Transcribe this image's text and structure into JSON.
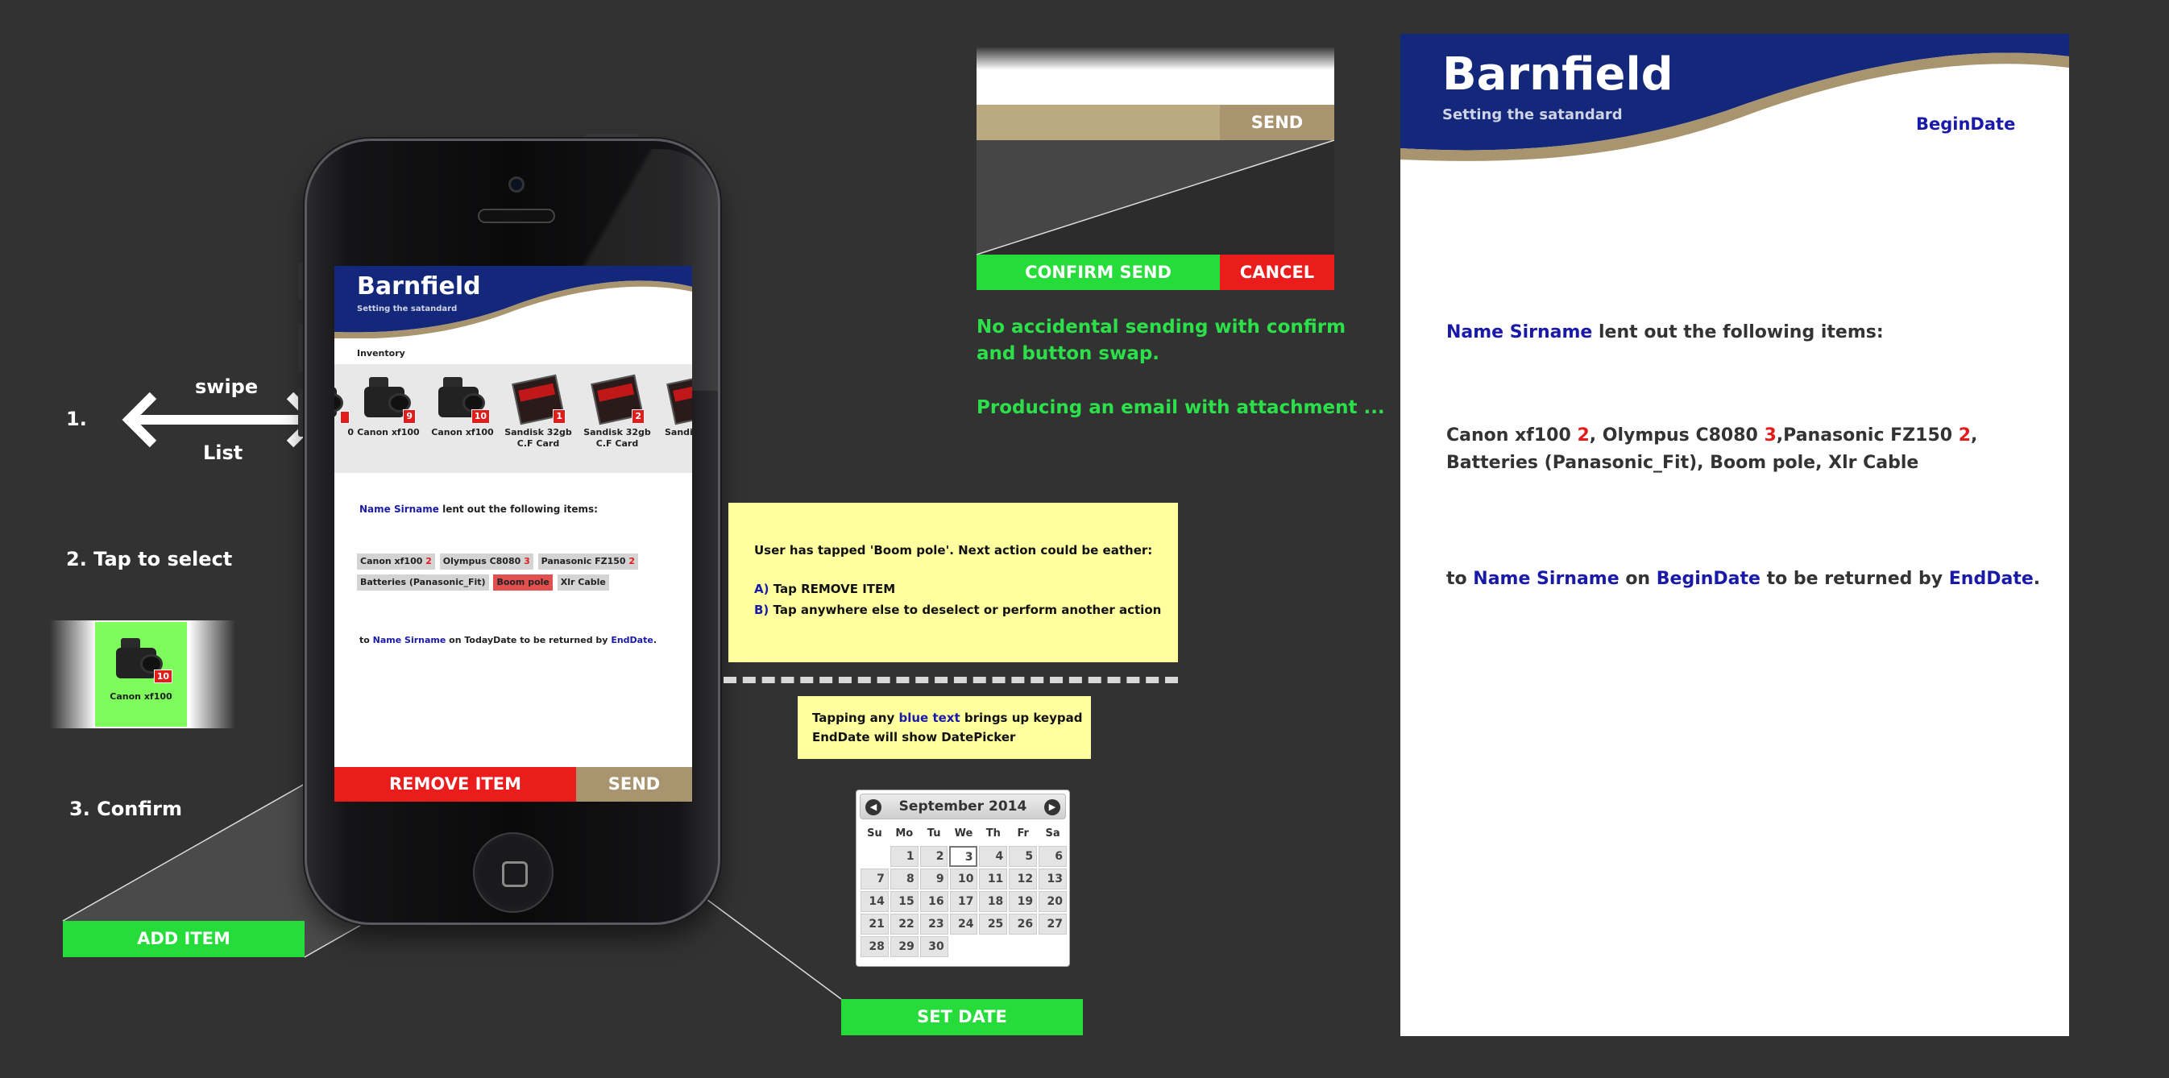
{
  "steps": {
    "s1_num": "1.",
    "s1_top": "swipe",
    "s1_bottom": "List",
    "s2": "2.  Tap to select",
    "s3": "3.  Confirm"
  },
  "selected_tile": {
    "label": "Canon xf100",
    "badge": "10"
  },
  "app": {
    "title": "Barnfield",
    "subtitle": "Setting the satandard",
    "inventory_label": "Inventory",
    "inventory": [
      {
        "label": "0",
        "badge": ""
      },
      {
        "label": "Canon xf100",
        "badge": "9"
      },
      {
        "label": "Canon xf100",
        "badge": "10"
      },
      {
        "label": "Sandisk 32gb C.F Card",
        "badge": "1"
      },
      {
        "label": "Sandisk 32gb C.F Card",
        "badge": "2"
      },
      {
        "label": "Sandis C.F",
        "badge": ""
      }
    ],
    "lent_name": "Name Sirname",
    "lent_text": " lent out the following items:",
    "chips": [
      {
        "label": "Canon xf100",
        "count": "2"
      },
      {
        "label": "Olympus C8080",
        "count": "3"
      },
      {
        "label": "Panasonic FZ150",
        "count": "2"
      },
      {
        "label": "Batteries (Panasonic_Fit)",
        "count": ""
      },
      {
        "label": "Boom pole",
        "count": ""
      },
      {
        "label": "Xlr Cable",
        "count": ""
      }
    ],
    "to_prefix": "to ",
    "to_name": "Name Sirname",
    "to_mid": " on TodayDate to be returned by ",
    "to_end": "EndDate",
    "to_dot": ".",
    "remove_button": "REMOVE ITEM",
    "send_button": "SEND"
  },
  "add_item_button": "ADD ITEM",
  "set_date_button": "SET DATE",
  "preview_send": "SEND",
  "confirm_send_button": "CONFIRM SEND",
  "cancel_button": "CANCEL",
  "notes": {
    "line1": "No accidental sending with confirm",
    "line2": "and button swap.",
    "line3": "Producing an email with attachment ..."
  },
  "note_box1": {
    "line1": "User has tapped 'Boom pole'. Next action could be eather:",
    "a_label": "A)",
    "a_text": " Tap REMOVE ITEM",
    "b_label": "B)",
    "b_text": " Tap anywhere else to deselect or perform another action"
  },
  "note_box2": {
    "prefix": "Tapping any ",
    "blue": "blue text",
    "suffix": " brings up keypad",
    "line2": "EndDate will show DatePicker"
  },
  "datepicker": {
    "month": "September 2014",
    "dow": [
      "Su",
      "Mo",
      "Tu",
      "We",
      "Th",
      "Fr",
      "Sa"
    ],
    "weeks": [
      [
        "",
        "1",
        "2",
        "3",
        "4",
        "5",
        "6"
      ],
      [
        "7",
        "8",
        "9",
        "10",
        "11",
        "12",
        "13"
      ],
      [
        "14",
        "15",
        "16",
        "17",
        "18",
        "19",
        "20"
      ],
      [
        "21",
        "22",
        "23",
        "24",
        "25",
        "26",
        "27"
      ],
      [
        "28",
        "29",
        "30",
        "",
        "",
        "",
        ""
      ]
    ],
    "today": "3"
  },
  "document": {
    "title": "Barnfield",
    "subtitle": "Setting the satandard",
    "begin_date": "BeginDate",
    "name": "Name Sirname",
    "lent_text": " lent out the following items:",
    "items_a": "Canon xf100 ",
    "items_a_n": "2",
    "items_b": ", Olympus C8080 ",
    "items_b_n": "3",
    "items_c": ",Panasonic FZ150 ",
    "items_c_n": "2",
    "items_d": ",",
    "items_line2": "Batteries (Panasonic_Fit), Boom pole, Xlr Cable",
    "to_prefix": "to ",
    "to_name": "Name Sirname",
    "to_on": " on ",
    "to_begin": "BeginDate",
    "to_mid": " to be returned by ",
    "to_end": "EndDate",
    "to_dot": "."
  },
  "colors": {
    "navy": "#13287a",
    "gold": "#a89570",
    "green": "#25dc3b",
    "red": "#ea1c1c",
    "note_yellow": "#ffffa0"
  }
}
